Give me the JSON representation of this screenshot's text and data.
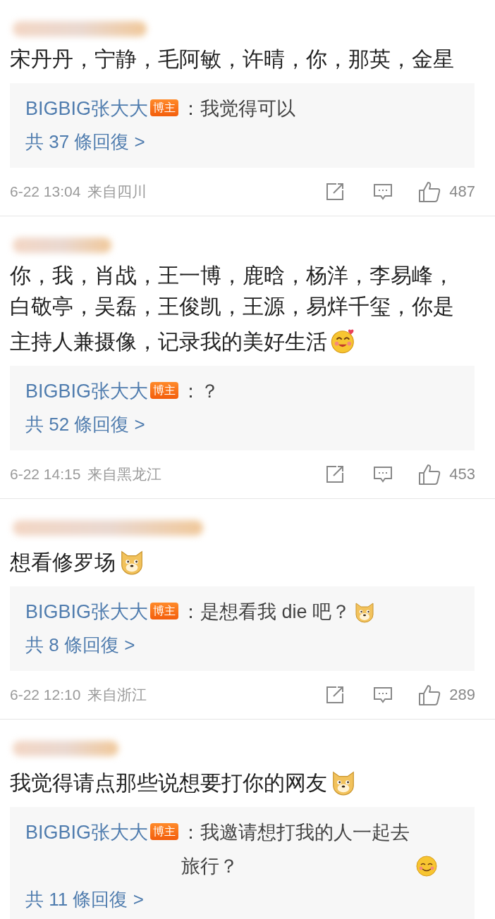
{
  "comments": [
    {
      "text": "宋丹丹，宁静，毛阿敏，许晴，你，那英，金星",
      "reply": {
        "author": "BIGBIG张大大",
        "badge": "博主",
        "text": "：我觉得可以",
        "count": "共 37 條回復 >"
      },
      "meta": {
        "time": "6-22 13:04",
        "location": "来自四川",
        "likes": "487"
      }
    },
    {
      "text": "你，我，肖战，王一博，鹿晗，杨洋，李易峰，白敬亭，吴磊，王俊凯，王源，易烊千玺，你是主持人兼摄像，记录我的美好生活",
      "emoji": {
        "kind": "blush"
      },
      "reply": {
        "author": "BIGBIG张大大",
        "badge": "博主",
        "text": "：？",
        "count": "共 52 條回復 >"
      },
      "meta": {
        "time": "6-22 14:15",
        "location": "来自黑龙江",
        "likes": "453"
      }
    },
    {
      "text": "想看修罗场",
      "emoji": {
        "kind": "dog"
      },
      "reply": {
        "author": "BIGBIG张大大",
        "badge": "博主",
        "text": "：是想看我 die 吧？",
        "emoji": {
          "kind": "dog"
        },
        "count": "共 8 條回復 >"
      },
      "meta": {
        "time": "6-22 12:10",
        "location": "来自浙江",
        "likes": "289"
      }
    },
    {
      "text": "我觉得请点那些说想要打你的网友",
      "emoji": {
        "kind": "dog"
      },
      "reply": {
        "author": "BIGBIG张大大",
        "badge": "博主",
        "text": "：我邀请想打我的人一起去旅行？",
        "emoji": {
          "kind": "smile"
        },
        "count": "共 11 條回復 >"
      }
    }
  ]
}
